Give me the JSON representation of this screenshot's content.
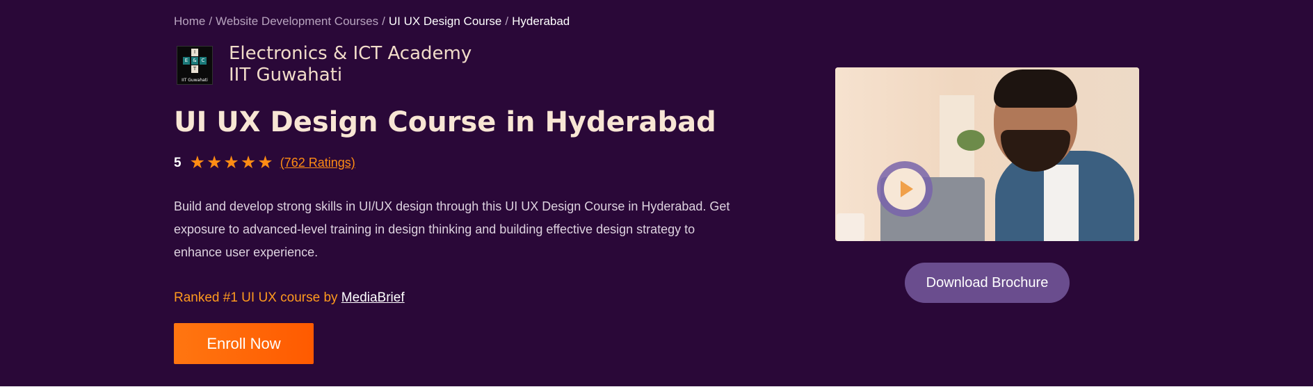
{
  "breadcrumb": {
    "items": [
      {
        "label": "Home"
      },
      {
        "label": "Website Development Courses"
      },
      {
        "label": "UI UX Design Course"
      },
      {
        "label": "Hyderabad"
      }
    ],
    "separator": "/"
  },
  "academy": {
    "logo_letters": [
      "E",
      "&",
      "C",
      "I",
      "T"
    ],
    "logo_caption": "IIT Guwahati",
    "line1": "Electronics & ICT Academy",
    "line2": "IIT Guwahati"
  },
  "hero": {
    "title": "UI UX Design Course in Hyderabad",
    "rating_score": "5",
    "star_count": 5,
    "ratings_text": "(762 Ratings)",
    "description": "Build and develop strong skills in UI/UX design through this UI UX Design Course in Hyderabad. Get exposure to advanced-level training in design thinking and building effective design strategy to enhance user experience.",
    "ranked_prefix": "Ranked #1 UI UX course by ",
    "ranked_source": "MediaBrief",
    "enroll_label": "Enroll Now"
  },
  "media": {
    "play_icon": "play-icon",
    "brochure_label": "Download Brochure"
  },
  "colors": {
    "background": "#2a0838",
    "accent_orange": "#ff7611",
    "brochure_purple": "#6a4d8e",
    "title_cream": "#f8e6d4"
  }
}
